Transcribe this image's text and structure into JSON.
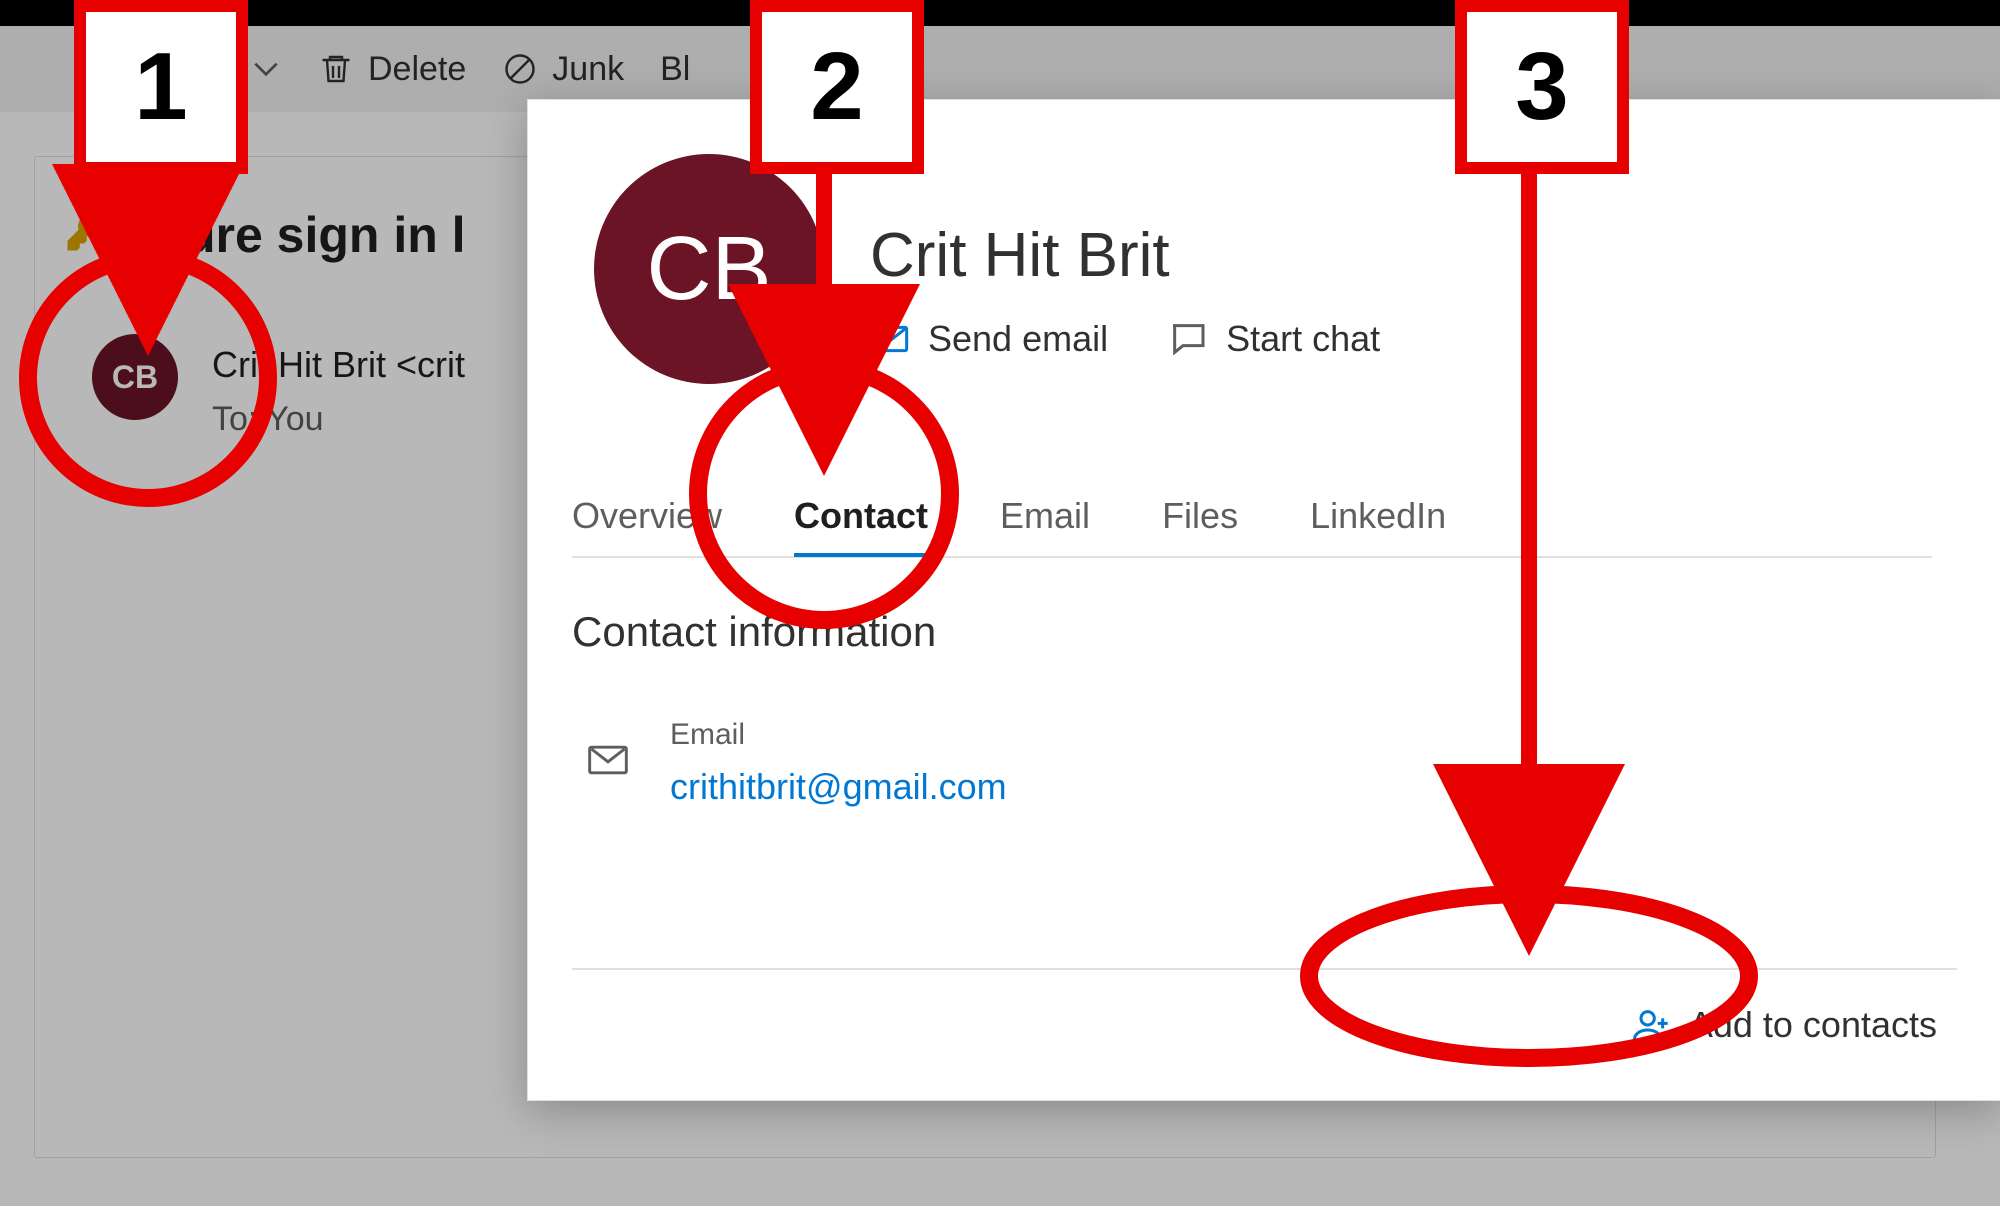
{
  "toolbar": {
    "delete_label": "Delete",
    "junk_label": "Junk",
    "block_prefix": "Bl"
  },
  "message": {
    "subject": "Secure sign in l",
    "avatar_initials": "CB",
    "sender_line": "Crit Hit Brit <crit",
    "to_line": "To: You"
  },
  "card": {
    "avatar_initials": "CB",
    "display_name": "Crit Hit Brit",
    "actions": {
      "send_email": "Send email",
      "start_chat": "Start chat"
    },
    "tabs": {
      "overview": "Overview",
      "contact": "Contact",
      "email": "Email",
      "files": "Files",
      "linkedin": "LinkedIn"
    },
    "section_title": "Contact information",
    "email_label": "Email",
    "email_value": "crithitbrit@gmail.com",
    "add_contacts": "Add to contacts"
  },
  "annotations": {
    "1": "1",
    "2": "2",
    "3": "3"
  },
  "colors": {
    "brand_blue": "#0078d4",
    "avatar_maroon": "#6a1425",
    "callout_red": "#e60000"
  }
}
